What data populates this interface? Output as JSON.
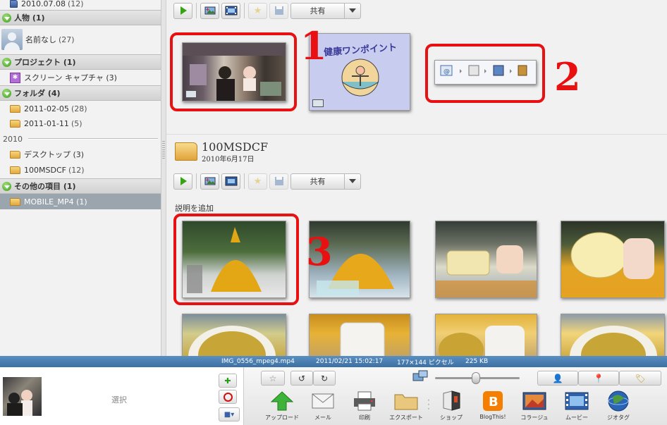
{
  "sidebar": {
    "top_item": {
      "label": "2010.07.08",
      "count": "(12)"
    },
    "section_people": {
      "label": "人物 (1)"
    },
    "person": {
      "label": "名前なし",
      "count": "(27)"
    },
    "section_projects": {
      "label": "プロジェクト (1)"
    },
    "project": {
      "label": "スクリーン キャプチャ (3)"
    },
    "section_folders": {
      "label": "フォルダ (4)"
    },
    "folders_2011": [
      {
        "label": "2011-02-05",
        "count": "(28)"
      },
      {
        "label": "2011-01-11",
        "count": "(5)"
      }
    ],
    "year_label": "2010",
    "folders_2010": [
      {
        "label": "デスクトップ (3)",
        "count": ""
      },
      {
        "label": "100MSDCF",
        "count": "(12)"
      }
    ],
    "section_other": {
      "label": "その他の項目 (1)"
    },
    "selected_item": {
      "label": "MOBILE_MP4 (1)"
    }
  },
  "toolbar": {
    "share_label": "共有"
  },
  "album": {
    "title": "100MSDCF",
    "date": "2010年6月17日",
    "add_description": "説明を追加"
  },
  "thumb_text": {
    "health_poster": "健康ワンポイント"
  },
  "annotations": [
    "1",
    "2",
    "3"
  ],
  "status": {
    "filename": "IMG_0556_mpeg4.mp4",
    "datetime": "2011/02/21 15:02:17",
    "dimensions": "177×144 ピクセル",
    "size": "225 KB"
  },
  "tray": {
    "label": "選択"
  },
  "actions": [
    {
      "label": "アップロード",
      "icon": "upload-arrow-icon"
    },
    {
      "label": "メール",
      "icon": "mail-icon"
    },
    {
      "label": "印刷",
      "icon": "printer-icon"
    },
    {
      "label": "エクスポート",
      "icon": "folder-icon"
    },
    {
      "label": "ショップ",
      "icon": "shop-icon"
    },
    {
      "label": "BlogThis!",
      "icon": "blogger-icon"
    },
    {
      "label": "コラージュ",
      "icon": "collage-icon"
    },
    {
      "label": "ムービー",
      "icon": "movie-icon"
    },
    {
      "label": "ジオタグ",
      "icon": "geotag-icon"
    }
  ],
  "colors": {
    "annotation_red": "#e81010",
    "status_blue": "#4a7eb3",
    "selected_gray": "#9aa5ae"
  }
}
